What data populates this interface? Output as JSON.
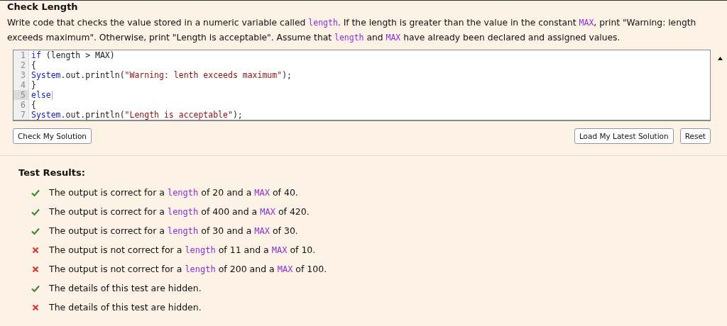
{
  "title": "Check Length",
  "description": [
    {
      "kind": "text",
      "text": "Write code that checks the value stored in a numeric variable called "
    },
    {
      "kind": "code",
      "text": "length"
    },
    {
      "kind": "text",
      "text": ". If the length is greater than the value in the constant "
    },
    {
      "kind": "code",
      "text": "MAX"
    },
    {
      "kind": "text",
      "text": ", print \"Warning: length exceeds maximum\". Otherwise, print \"Length is acceptable\". Assume that "
    },
    {
      "kind": "code",
      "text": "length"
    },
    {
      "kind": "text",
      "text": " and "
    },
    {
      "kind": "code",
      "text": "MAX"
    },
    {
      "kind": "text",
      "text": " have already been declared and assigned values."
    }
  ],
  "editor": {
    "lines": [
      {
        "number": "1",
        "active": false,
        "tokens": [
          {
            "kind": "keyword",
            "text": "if"
          },
          {
            "kind": "plain",
            "text": " (length > MAX)"
          }
        ]
      },
      {
        "number": "2",
        "active": false,
        "tokens": [
          {
            "kind": "plain",
            "text": "{"
          }
        ]
      },
      {
        "number": "3",
        "active": false,
        "tokens": [
          {
            "kind": "keyword",
            "text": "System"
          },
          {
            "kind": "plain",
            "text": ".out.println("
          },
          {
            "kind": "string",
            "text": "\"Warning: lenth exceeds maximum\""
          },
          {
            "kind": "plain",
            "text": ");"
          }
        ]
      },
      {
        "number": "4",
        "active": false,
        "tokens": [
          {
            "kind": "plain",
            "text": "}"
          }
        ]
      },
      {
        "number": "5",
        "active": true,
        "tokens": [
          {
            "kind": "keyword",
            "text": "else"
          }
        ]
      },
      {
        "number": "6",
        "active": false,
        "tokens": [
          {
            "kind": "plain",
            "text": "{"
          }
        ]
      },
      {
        "number": "7",
        "active": false,
        "tokens": [
          {
            "kind": "keyword",
            "text": "System"
          },
          {
            "kind": "plain",
            "text": ".out.println("
          },
          {
            "kind": "string",
            "text": "\"Length is acceptable\""
          },
          {
            "kind": "plain",
            "text": ");"
          }
        ]
      }
    ]
  },
  "buttons_left": [
    "Check My Solution"
  ],
  "buttons_right": [
    "Load My Latest Solution",
    "Reset"
  ],
  "results_title": "Test Results:",
  "results": [
    {
      "passed": true,
      "segments": [
        {
          "kind": "text",
          "text": "The output is correct for a "
        },
        {
          "kind": "code",
          "text": "length"
        },
        {
          "kind": "text",
          "text": " of 20 and a "
        },
        {
          "kind": "code",
          "text": "MAX"
        },
        {
          "kind": "text",
          "text": " of 40."
        }
      ]
    },
    {
      "passed": true,
      "segments": [
        {
          "kind": "text",
          "text": "The output is correct for a "
        },
        {
          "kind": "code",
          "text": "length"
        },
        {
          "kind": "text",
          "text": " of 400 and a "
        },
        {
          "kind": "code",
          "text": "MAX"
        },
        {
          "kind": "text",
          "text": " of 420."
        }
      ]
    },
    {
      "passed": true,
      "segments": [
        {
          "kind": "text",
          "text": "The output is correct for a "
        },
        {
          "kind": "code",
          "text": "length"
        },
        {
          "kind": "text",
          "text": " of 30 and a "
        },
        {
          "kind": "code",
          "text": "MAX"
        },
        {
          "kind": "text",
          "text": " of 30."
        }
      ]
    },
    {
      "passed": false,
      "segments": [
        {
          "kind": "text",
          "text": "The output is not correct for a "
        },
        {
          "kind": "code",
          "text": "length"
        },
        {
          "kind": "text",
          "text": " of 11 and a "
        },
        {
          "kind": "code",
          "text": "MAX"
        },
        {
          "kind": "text",
          "text": " of 10."
        }
      ]
    },
    {
      "passed": false,
      "segments": [
        {
          "kind": "text",
          "text": "The output is not correct for a "
        },
        {
          "kind": "code",
          "text": "length"
        },
        {
          "kind": "text",
          "text": " of 200 and a "
        },
        {
          "kind": "code",
          "text": "MAX"
        },
        {
          "kind": "text",
          "text": " of 100."
        }
      ]
    },
    {
      "passed": true,
      "segments": [
        {
          "kind": "text",
          "text": "The details of this test are hidden."
        }
      ]
    },
    {
      "passed": false,
      "segments": [
        {
          "kind": "text",
          "text": "The details of this test are hidden."
        }
      ]
    }
  ]
}
